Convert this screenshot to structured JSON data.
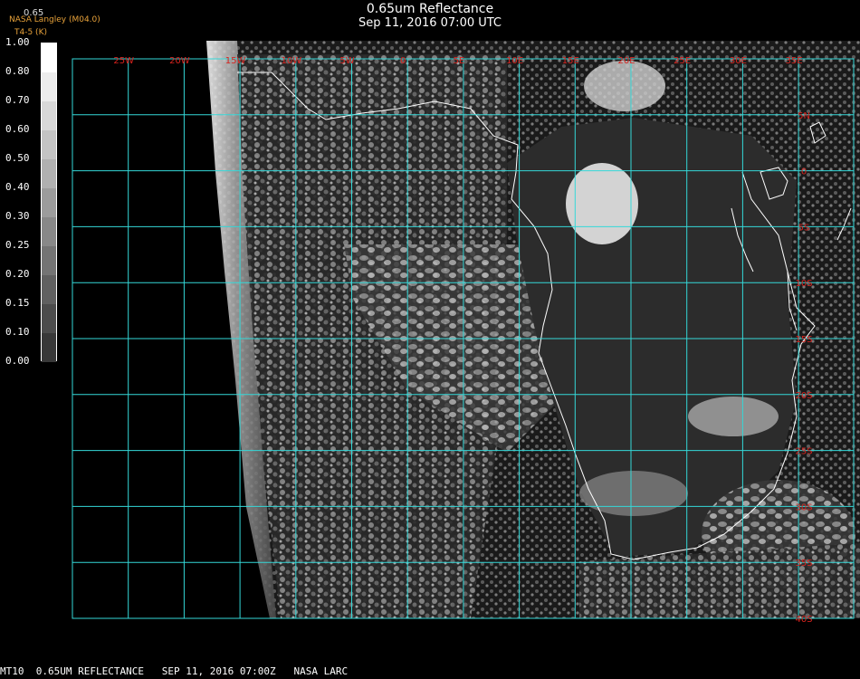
{
  "header": {
    "title": "0.65um Reflectance",
    "timestamp": "Sep 11, 2016 07:00 UTC",
    "credit": "NASA Langley (M04.0)",
    "product": "T4-5 (K)"
  },
  "legend": {
    "unit": "0.65",
    "ticks": [
      "1.00",
      "0.80",
      "0.70",
      "0.60",
      "0.50",
      "0.40",
      "0.30",
      "0.25",
      "0.20",
      "0.15",
      "0.10",
      "0.00"
    ],
    "shades": [
      "#ffffff",
      "#ececec",
      "#d8d8d8",
      "#c4c4c4",
      "#b0b0b0",
      "#9c9c9c",
      "#888888",
      "#747474",
      "#606060",
      "#4c4c4c",
      "#383838",
      "#000000"
    ]
  },
  "map": {
    "grid_color": "#34d8d8",
    "label_color": "#d9231e",
    "coast_color": "#ffffff",
    "longitude_labels": [
      "25W",
      "20W",
      "15W",
      "10W",
      "5W",
      "0",
      "5E",
      "10E",
      "15E",
      "20E",
      "25E",
      "30E",
      "35E"
    ],
    "latitude_labels": [
      "5N",
      "0",
      "5S",
      "10S",
      "15S",
      "20S",
      "25S",
      "30S",
      "35S",
      "40S"
    ]
  },
  "footer": {
    "text": "MT10  0.65UM REFLECTANCE   SEP 11, 2016 07:00Z   NASA LARC"
  }
}
